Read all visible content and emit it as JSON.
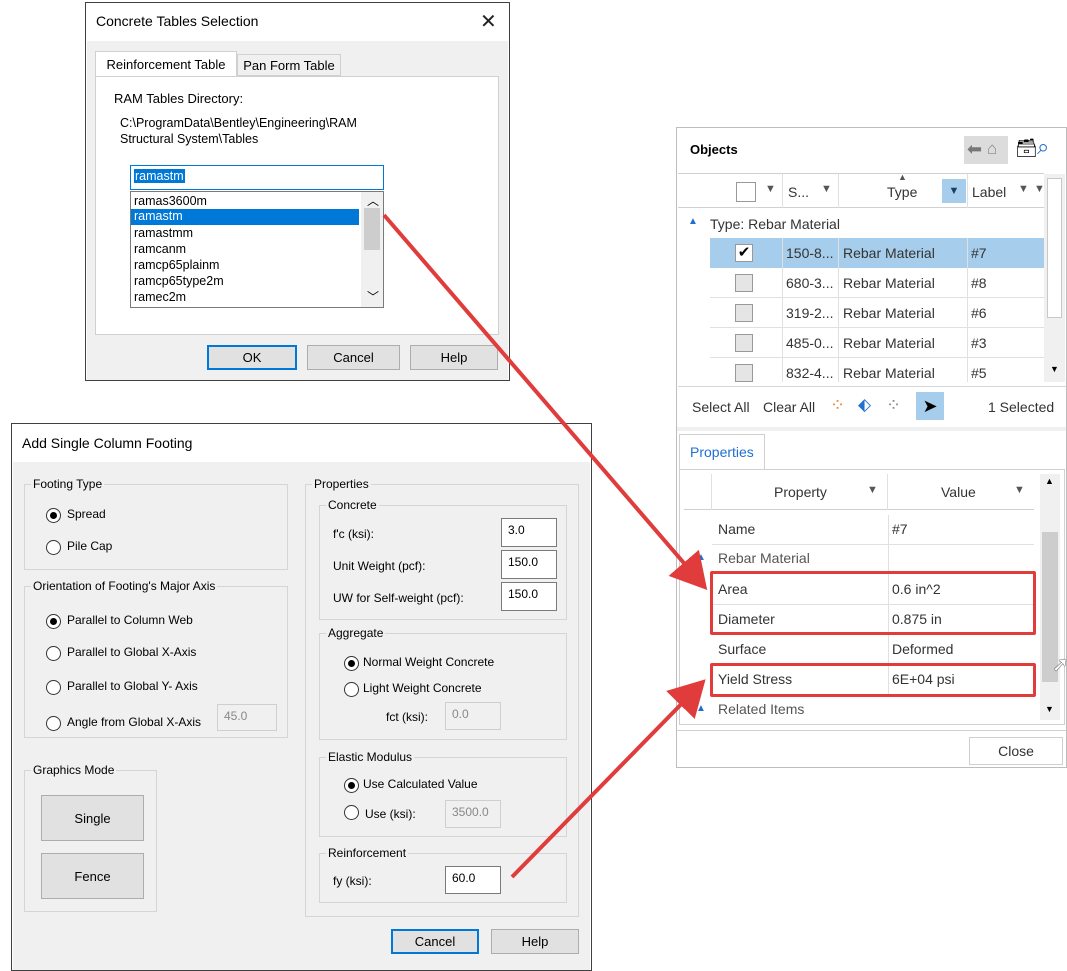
{
  "concrete_dialog": {
    "title": "Concrete Tables Selection",
    "tabs": [
      "Reinforcement Table",
      "Pan Form Table"
    ],
    "dir_label": "RAM Tables Directory:",
    "dir_path_line1": "C:\\ProgramData\\Bentley\\Engineering\\RAM",
    "dir_path_line2": "Structural System\\Tables",
    "selected_value": "ramastm",
    "list_items": [
      "ramas3600m",
      "ramastm",
      "ramastmm",
      "ramcanm",
      "ramcp65plainm",
      "ramcp65type2m",
      "ramec2m"
    ],
    "ok": "OK",
    "cancel": "Cancel",
    "help": "Help"
  },
  "footing_dialog": {
    "title": "Add Single Column Footing",
    "footing_type": {
      "label": "Footing Type",
      "options": [
        "Spread",
        "Pile Cap"
      ]
    },
    "orientation": {
      "label": "Orientation of Footing's Major Axis",
      "options": [
        "Parallel to Column Web",
        "Parallel to Global X-Axis",
        "Parallel to Global Y- Axis",
        "Angle from Global X-Axis"
      ],
      "angle_value": "45.0"
    },
    "graphics": {
      "label": "Graphics Mode",
      "single": "Single",
      "fence": "Fence"
    },
    "properties": {
      "label": "Properties",
      "concrete": {
        "label": "Concrete",
        "fc_label": "f'c (ksi):",
        "fc_value": "3.0",
        "uw_label": "Unit Weight (pcf):",
        "uw_value": "150.0",
        "uwsw_label": "UW for Self-weight (pcf):",
        "uwsw_value": "150.0"
      },
      "aggregate": {
        "label": "Aggregate",
        "normal": "Normal Weight Concrete",
        "light": "Light Weight Concrete",
        "fct_label": "fct (ksi):",
        "fct_value": "0.0"
      },
      "elastic": {
        "label": "Elastic Modulus",
        "calc": "Use Calculated Value",
        "use": "Use (ksi):",
        "use_value": "3500.0"
      },
      "reinforcement": {
        "label": "Reinforcement",
        "fy_label": "fy (ksi):",
        "fy_value": "60.0"
      }
    },
    "cancel": "Cancel",
    "help": "Help"
  },
  "objects_panel": {
    "title": "Objects",
    "columns": [
      "S...",
      "Type",
      "Label"
    ],
    "group_label": "Type: Rebar Material",
    "rows": [
      {
        "s": "150-8...",
        "type": "Rebar Material",
        "label": "#7",
        "checked": true
      },
      {
        "s": "680-3...",
        "type": "Rebar Material",
        "label": "#8",
        "checked": false
      },
      {
        "s": "319-2...",
        "type": "Rebar Material",
        "label": "#6",
        "checked": false
      },
      {
        "s": "485-0...",
        "type": "Rebar Material",
        "label": "#3",
        "checked": false
      },
      {
        "s": "832-4...",
        "type": "Rebar Material",
        "label": "#5",
        "checked": false
      }
    ],
    "select_all": "Select All",
    "clear_all": "Clear All",
    "selected_count": "1 Selected",
    "properties_tab": "Properties",
    "prop_header": "Property",
    "value_header": "Value",
    "name_row": {
      "property": "Name",
      "value": "#7"
    },
    "rebar_group": "Rebar Material",
    "prop_rows": [
      {
        "property": "Area",
        "value": "0.6 in^2"
      },
      {
        "property": "Diameter",
        "value": "0.875 in"
      },
      {
        "property": "Surface",
        "value": "Deformed"
      },
      {
        "property": "Yield Stress",
        "value": "6E+04 psi"
      }
    ],
    "related_group": "Related Items",
    "close": "Close"
  },
  "colors": {
    "accent_blue": "#0078d7",
    "selection_highlight": "#a6cdeb",
    "arrow_red": "#e03c3c"
  }
}
